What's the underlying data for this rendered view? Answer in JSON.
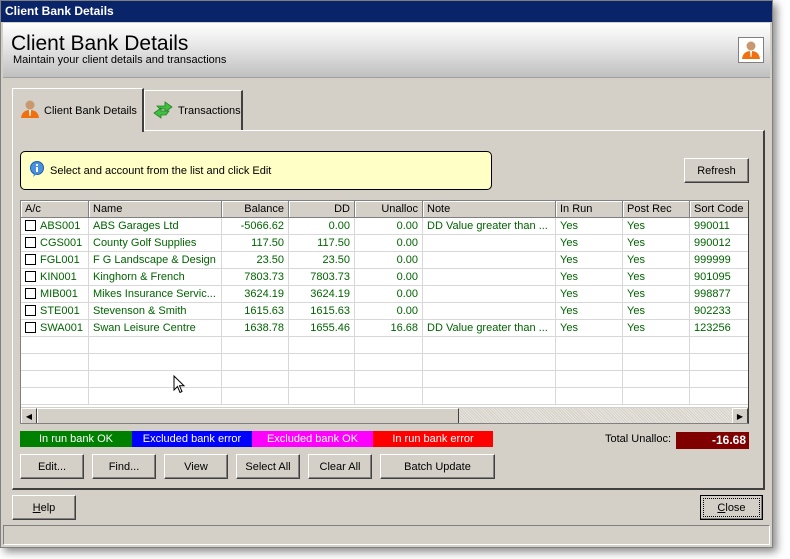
{
  "window": {
    "title": "Client Bank Details"
  },
  "header": {
    "title": "Client Bank Details",
    "subtitle": "Maintain your client details and transactions",
    "icon": "person-icon"
  },
  "tabs": [
    {
      "label": "Client Bank Details",
      "icon": "person-icon",
      "active": true
    },
    {
      "label": "Transactions",
      "icon": "exchange-arrows-icon",
      "active": false
    }
  ],
  "info": {
    "icon": "info-icon",
    "text": "Select and account from the list and click Edit"
  },
  "refresh_label": "Refresh",
  "grid": {
    "columns": [
      "A/c",
      "Name",
      "Balance",
      "DD",
      "Unalloc",
      "Note",
      "In Run",
      "Post Rec",
      "Sort Code"
    ],
    "rows": [
      {
        "checked": false,
        "ac": "ABS001",
        "name": "ABS Garages Ltd",
        "balance": "-5066.62",
        "dd": "0.00",
        "unalloc": "0.00",
        "note": "DD Value greater than ...",
        "in_run": "Yes",
        "post_rec": "Yes",
        "sort_code": "990011"
      },
      {
        "checked": false,
        "ac": "CGS001",
        "name": "County Golf Supplies",
        "balance": "117.50",
        "dd": "117.50",
        "unalloc": "0.00",
        "note": "",
        "in_run": "Yes",
        "post_rec": "Yes",
        "sort_code": "990012"
      },
      {
        "checked": false,
        "ac": "FGL001",
        "name": "F G Landscape & Design",
        "balance": "23.50",
        "dd": "23.50",
        "unalloc": "0.00",
        "note": "",
        "in_run": "Yes",
        "post_rec": "Yes",
        "sort_code": "999999"
      },
      {
        "checked": false,
        "ac": "KIN001",
        "name": "Kinghorn & French",
        "balance": "7803.73",
        "dd": "7803.73",
        "unalloc": "0.00",
        "note": "",
        "in_run": "Yes",
        "post_rec": "Yes",
        "sort_code": "901095"
      },
      {
        "checked": false,
        "ac": "MIB001",
        "name": "Mikes Insurance Servic...",
        "balance": "3624.19",
        "dd": "3624.19",
        "unalloc": "0.00",
        "note": "",
        "in_run": "Yes",
        "post_rec": "Yes",
        "sort_code": "998877"
      },
      {
        "checked": false,
        "ac": "STE001",
        "name": "Stevenson & Smith",
        "balance": "1615.63",
        "dd": "1615.63",
        "unalloc": "0.00",
        "note": "",
        "in_run": "Yes",
        "post_rec": "Yes",
        "sort_code": "902233"
      },
      {
        "checked": false,
        "ac": "SWA001",
        "name": "Swan Leisure Centre",
        "balance": "1638.78",
        "dd": "1655.46",
        "unalloc": "16.68",
        "note": "DD Value greater than ...",
        "in_run": "Yes",
        "post_rec": "Yes",
        "sort_code": "123256"
      }
    ],
    "text_color": "#006400"
  },
  "legend": [
    {
      "label": "In run bank OK",
      "color": "#008000"
    },
    {
      "label": "Excluded bank error",
      "color": "#0000ff"
    },
    {
      "label": "Excluded bank OK",
      "color": "#ff00ff"
    },
    {
      "label": "In run bank error",
      "color": "#ff0000"
    }
  ],
  "total": {
    "label": "Total Unalloc:",
    "value": "-16.68",
    "color": "#800000"
  },
  "buttons": {
    "edit": "Edit...",
    "find": "Find...",
    "view": "View",
    "select_all": "Select All",
    "clear_all": "Clear All",
    "batch_update": "Batch Update",
    "help_prefix": "H",
    "help_rest": "elp",
    "close_prefix": "C",
    "close_rest": "lose"
  }
}
